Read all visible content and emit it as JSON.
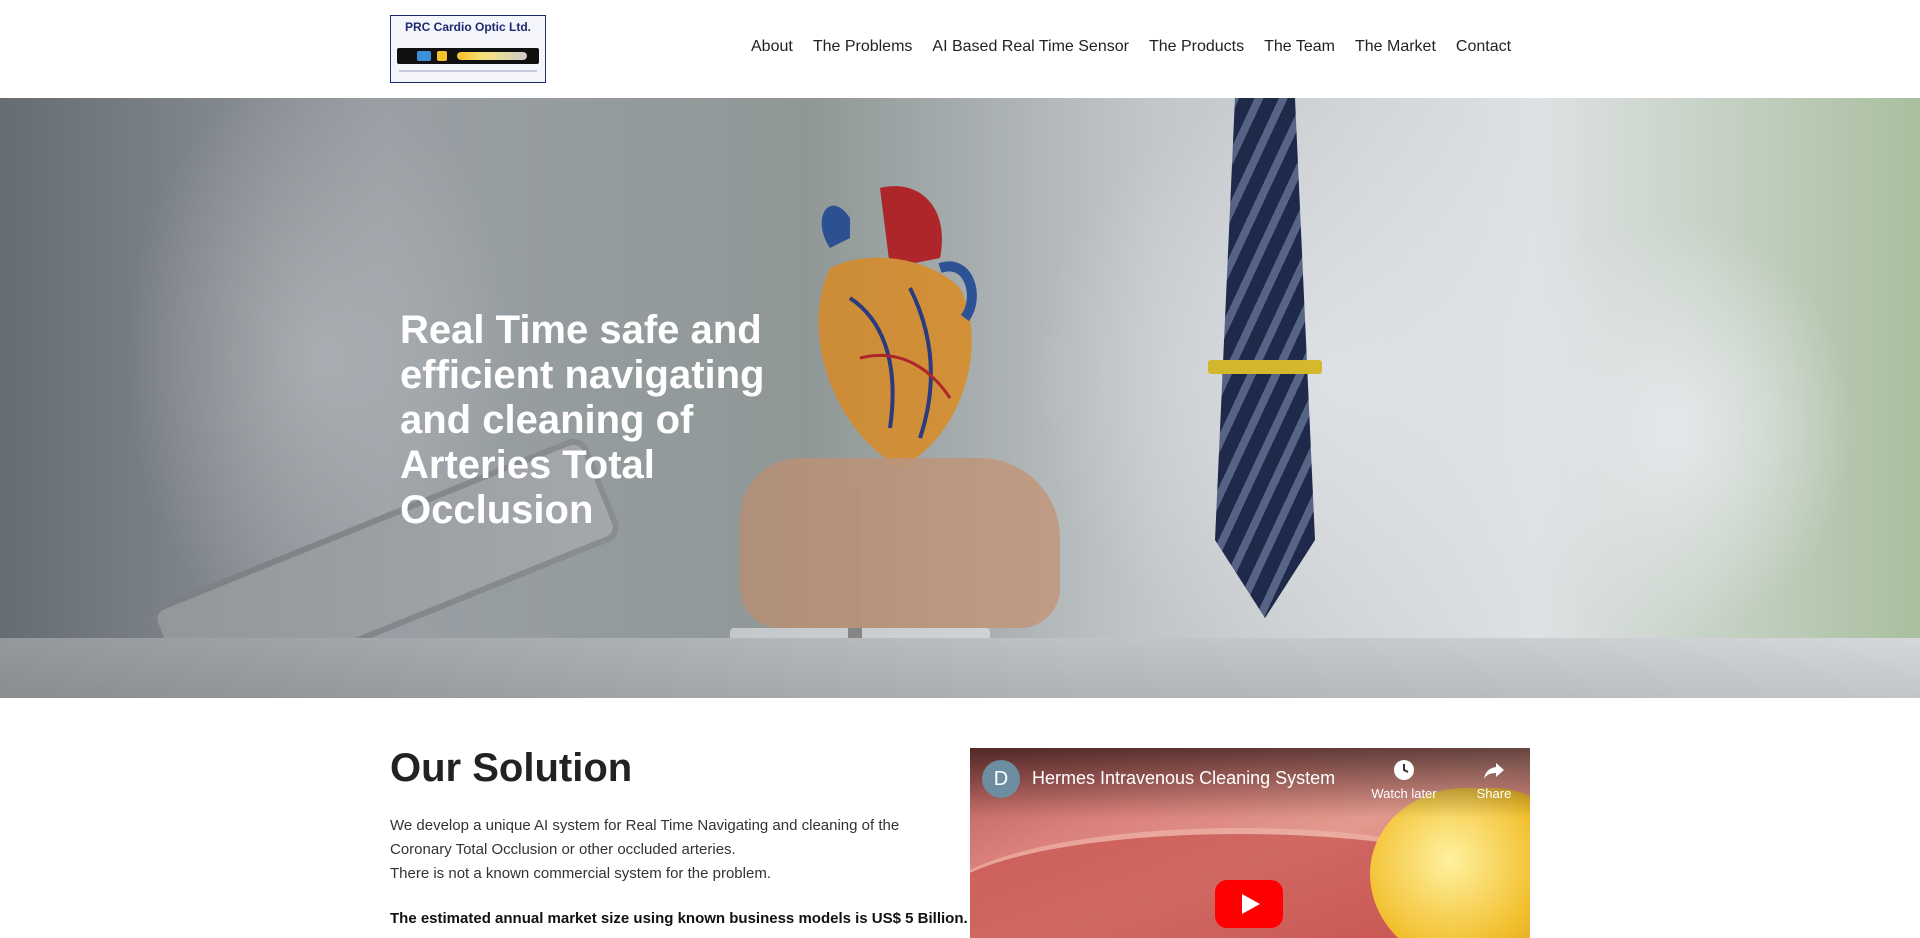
{
  "logo": {
    "text": "PRC Cardio Optic Ltd."
  },
  "nav": {
    "items": [
      "About",
      "The Problems",
      "AI Based Real Time Sensor",
      "The Products",
      "The Team",
      "The Market",
      "Contact"
    ]
  },
  "hero": {
    "title": "Real Time safe and efficient navigating and cleaning of Arteries Total Occlusion"
  },
  "solution": {
    "title": "Our Solution",
    "line1": "We develop a unique AI system for Real Time Navigating and cleaning of the Coronary Total Occlusion or other occluded arteries.",
    "line2": "There is not a known commercial system for the problem.",
    "bold": "The estimated annual market size using known business models is US$ 5 Billion."
  },
  "video": {
    "channel_initial": "D",
    "title": "Hermes Intravenous Cleaning System",
    "watch_later_label": "Watch later",
    "share_label": "Share",
    "icons": {
      "watch_later": "clock-icon",
      "share": "share-arrow-icon",
      "play": "play-icon"
    },
    "colors": {
      "play_button": "#ff0000"
    }
  },
  "colors": {
    "nav_text": "#222222",
    "hero_text": "#ffffff",
    "logo_border": "#1e2a6e"
  }
}
